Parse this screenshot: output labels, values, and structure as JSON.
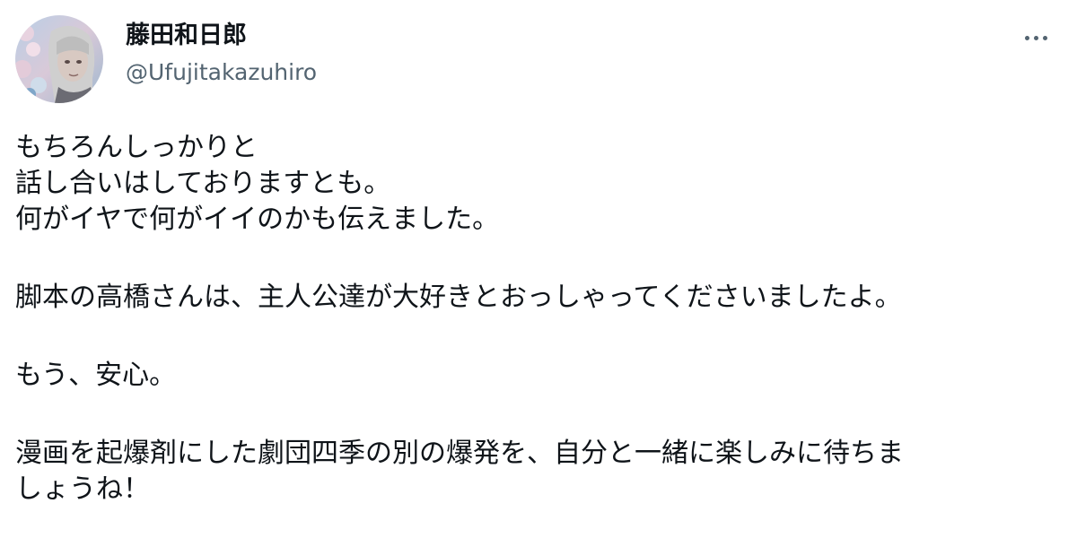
{
  "author": {
    "display_name": "藤田和日郎",
    "handle": "@Ufujitakazuhiro",
    "avatar_icon": "profile-photo"
  },
  "menu": {
    "more_icon": "more-horizontal-icon"
  },
  "tweet": {
    "paragraphs": [
      [
        "もちろんしっかりと",
        "話し合いはしておりますとも。",
        "何がイヤで何がイイのかも伝えました。"
      ],
      [
        "脚本の高橋さんは、主人公達が大好きとおっしゃってくださいましたよ。"
      ],
      [
        "もう、安心。"
      ],
      [
        "漫画を起爆剤にした劇団四季の別の爆発を、自分と一緒に楽しみに待ちま",
        "しょうね！"
      ]
    ]
  },
  "colors": {
    "text_primary": "#0f1419",
    "text_secondary": "#536471",
    "background": "#ffffff"
  }
}
